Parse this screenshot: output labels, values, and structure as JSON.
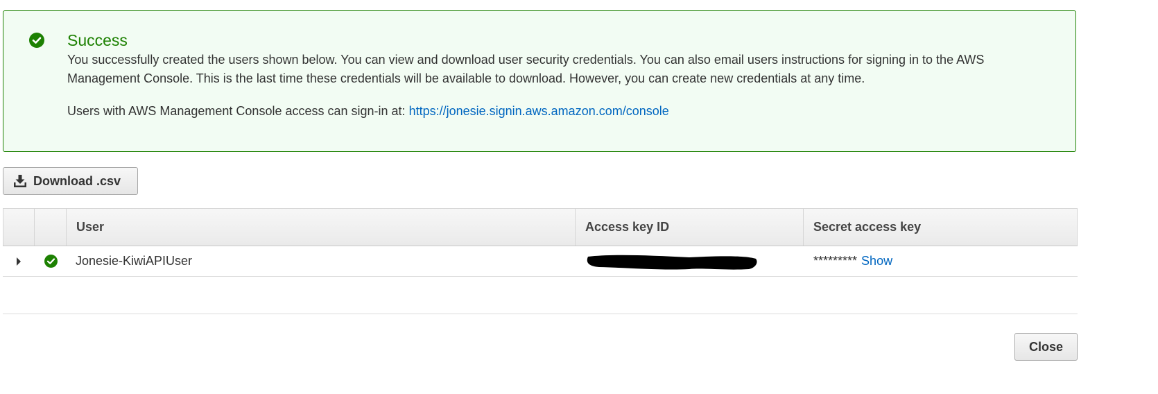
{
  "alert": {
    "icon": "check-circle-icon",
    "title": "Success",
    "body": "You successfully created the users shown below. You can view and download user security credentials. You can also email users instructions for signing in to the AWS Management Console. This is the last time these credentials will be available to download. However, you can create new credentials at any time.",
    "signin_prefix": "Users with AWS Management Console access can sign-in at: ",
    "signin_url": "https://jonesie.signin.aws.amazon.com/console",
    "accent_color": "#1d8102"
  },
  "toolbar": {
    "download_icon": "download-icon",
    "download_label": "Download .csv"
  },
  "table": {
    "columns": {
      "user": "User",
      "access_key_id": "Access key ID",
      "secret_access_key": "Secret access key"
    },
    "rows": [
      {
        "expand_icon": "caret-right-icon",
        "status_icon": "check-circle-icon",
        "user": "Jonesie-KiwiAPIUser",
        "access_key_id_redacted": true,
        "secret_masked": "*********",
        "secret_show_label": "Show"
      }
    ]
  },
  "footer": {
    "close_label": "Close"
  },
  "colors": {
    "link": "#0066c0",
    "success": "#1d8102"
  }
}
